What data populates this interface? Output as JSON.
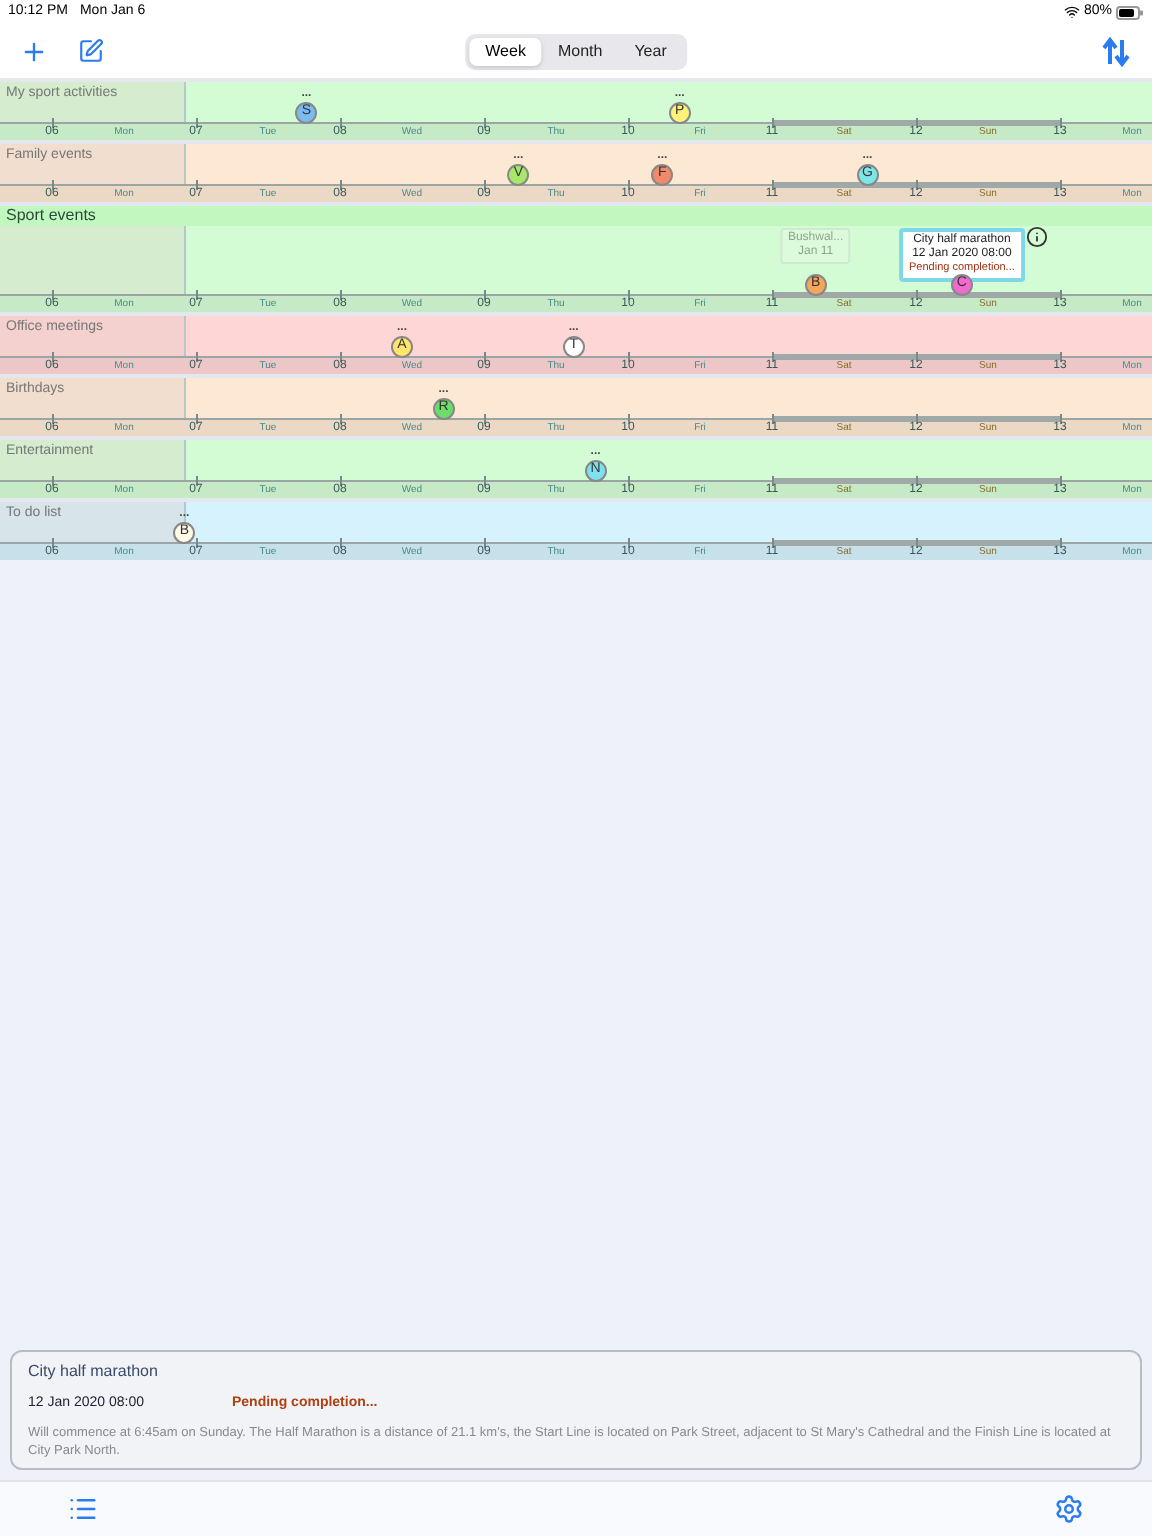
{
  "status_bar": {
    "time": "10:12 PM",
    "date": "Mon Jan 6",
    "battery": "80%"
  },
  "toolbar": {
    "segments": [
      {
        "label": "Week",
        "selected": true
      },
      {
        "label": "Month",
        "selected": false
      },
      {
        "label": "Year",
        "selected": false
      }
    ]
  },
  "now": {
    "level": 0.161
  },
  "rows": [
    {
      "title": "My sport activities",
      "expanded": false,
      "color": "#d4fcd4",
      "markers": [
        {
          "letter": "S",
          "level": 0.266,
          "color": "#7bbcf0",
          "more": "..."
        },
        {
          "letter": "P",
          "level": 0.59,
          "color": "#fff27a",
          "more": "..."
        }
      ],
      "ticks": [
        {
          "date": "06",
          "day": "Mon",
          "weekend": false
        },
        {
          "date": "07",
          "day": "Tue",
          "weekend": false
        },
        {
          "date": "08",
          "day": "Wed",
          "weekend": false
        },
        {
          "date": "09",
          "day": "Thu",
          "weekend": false
        },
        {
          "date": "10",
          "day": "Fri",
          "weekend": false
        },
        {
          "date": "11",
          "day": "Sat",
          "weekend": true
        },
        {
          "date": "12",
          "day": "Sun",
          "weekend": true
        },
        {
          "date": "13",
          "day": "Mon",
          "weekend": false
        }
      ]
    },
    {
      "title": "Family events",
      "expanded": false,
      "color": "#fde8d4",
      "markers": [
        {
          "letter": "V",
          "level": 0.45,
          "color": "#a7e86a",
          "more": "..."
        },
        {
          "letter": "F",
          "level": 0.575,
          "color": "#f08a6a",
          "more": "..."
        },
        {
          "letter": "G",
          "level": 0.753,
          "color": "#7ee8e8",
          "more": "..."
        }
      ],
      "ticks": [
        {
          "date": "06",
          "day": "Mon",
          "weekend": false
        },
        {
          "date": "07",
          "day": "Tue",
          "weekend": false
        },
        {
          "date": "08",
          "day": "Wed",
          "weekend": false
        },
        {
          "date": "09",
          "day": "Thu",
          "weekend": false
        },
        {
          "date": "10",
          "day": "Fri",
          "weekend": false
        },
        {
          "date": "11",
          "day": "Sat",
          "weekend": true
        },
        {
          "date": "12",
          "day": "Sun",
          "weekend": true
        },
        {
          "date": "13",
          "day": "Mon",
          "weekend": false
        }
      ]
    },
    {
      "title": "Sport events",
      "expanded": true,
      "color": "#d4fcd4",
      "markers": [
        {
          "letter": "B",
          "level": 0.708,
          "color": "#f5a65a",
          "callout": {
            "title": "Bushwal...",
            "date": "Jan 11",
            "faded": true
          }
        },
        {
          "letter": "C",
          "level": 0.835,
          "color": "#f06ad0",
          "callout": {
            "title": "City half marathon",
            "date": "12 Jan 2020 08:00",
            "status": "Pending completion...",
            "faded": false
          }
        }
      ],
      "ticks": [
        {
          "date": "06",
          "day": "Mon",
          "weekend": false
        },
        {
          "date": "07",
          "day": "Tue",
          "weekend": false
        },
        {
          "date": "08",
          "day": "Wed",
          "weekend": false
        },
        {
          "date": "09",
          "day": "Thu",
          "weekend": false
        },
        {
          "date": "10",
          "day": "Fri",
          "weekend": false
        },
        {
          "date": "11",
          "day": "Sat",
          "weekend": true
        },
        {
          "date": "12",
          "day": "Sun",
          "weekend": true
        },
        {
          "date": "13",
          "day": "Mon",
          "weekend": false
        }
      ]
    },
    {
      "title": "Office meetings",
      "expanded": false,
      "color": "#ffd6d6",
      "markers": [
        {
          "letter": "A",
          "level": 0.349,
          "color": "#ffe66a",
          "more": "..."
        },
        {
          "letter": "T",
          "level": 0.498,
          "color": "#ffffff",
          "more": "..."
        }
      ],
      "ticks": [
        {
          "date": "06",
          "day": "Mon",
          "weekend": false
        },
        {
          "date": "07",
          "day": "Tue",
          "weekend": false
        },
        {
          "date": "08",
          "day": "Wed",
          "weekend": false
        },
        {
          "date": "09",
          "day": "Thu",
          "weekend": false
        },
        {
          "date": "10",
          "day": "Fri",
          "weekend": false
        },
        {
          "date": "11",
          "day": "Sat",
          "weekend": true
        },
        {
          "date": "12",
          "day": "Sun",
          "weekend": true
        },
        {
          "date": "13",
          "day": "Mon",
          "weekend": false
        }
      ]
    },
    {
      "title": "Birthdays",
      "expanded": false,
      "color": "#fde8d4",
      "markers": [
        {
          "letter": "R",
          "level": 0.385,
          "color": "#6ade6a",
          "more": "..."
        }
      ],
      "ticks": [
        {
          "date": "06",
          "day": "Mon",
          "weekend": false
        },
        {
          "date": "07",
          "day": "Tue",
          "weekend": false
        },
        {
          "date": "08",
          "day": "Wed",
          "weekend": false
        },
        {
          "date": "09",
          "day": "Thu",
          "weekend": false
        },
        {
          "date": "10",
          "day": "Fri",
          "weekend": false
        },
        {
          "date": "11",
          "day": "Sat",
          "weekend": true
        },
        {
          "date": "12",
          "day": "Sun",
          "weekend": true
        },
        {
          "date": "13",
          "day": "Mon",
          "weekend": false
        }
      ]
    },
    {
      "title": "Entertainment",
      "expanded": false,
      "color": "#d4fcd4",
      "markers": [
        {
          "letter": "N",
          "level": 0.517,
          "color": "#7ee0f0",
          "more": "..."
        }
      ],
      "ticks": [
        {
          "date": "06",
          "day": "Mon",
          "weekend": false
        },
        {
          "date": "07",
          "day": "Tue",
          "weekend": false
        },
        {
          "date": "08",
          "day": "Wed",
          "weekend": false
        },
        {
          "date": "09",
          "day": "Thu",
          "weekend": false
        },
        {
          "date": "10",
          "day": "Fri",
          "weekend": false
        },
        {
          "date": "11",
          "day": "Sat",
          "weekend": true
        },
        {
          "date": "12",
          "day": "Sun",
          "weekend": true
        },
        {
          "date": "13",
          "day": "Mon",
          "weekend": false
        }
      ]
    },
    {
      "title": "To do list",
      "expanded": false,
      "color": "#d6f2fc",
      "markers": [
        {
          "letter": "B",
          "level": 0.16,
          "color": "#fffbe8",
          "more": "..."
        }
      ],
      "ticks": [
        {
          "date": "06",
          "day": "Mon",
          "weekend": false
        },
        {
          "date": "07",
          "day": "Tue",
          "weekend": false
        },
        {
          "date": "08",
          "day": "Wed",
          "weekend": false
        },
        {
          "date": "09",
          "day": "Thu",
          "weekend": false
        },
        {
          "date": "10",
          "day": "Fri",
          "weekend": false
        },
        {
          "date": "11",
          "day": "Sat",
          "weekend": true
        },
        {
          "date": "12",
          "day": "Sun",
          "weekend": true
        },
        {
          "date": "13",
          "day": "Mon",
          "weekend": false
        }
      ]
    }
  ],
  "details": {
    "title": "City half marathon",
    "date": "12 Jan 2020 08:00",
    "status": "Pending completion...",
    "description": "Will commence at 6:45am on Sunday. The Half Marathon is a distance of 21.1 km's, the Start Line is located on Park Street, adjacent to St Mary's Cathedral and the Finish Line is located at City Park North."
  }
}
